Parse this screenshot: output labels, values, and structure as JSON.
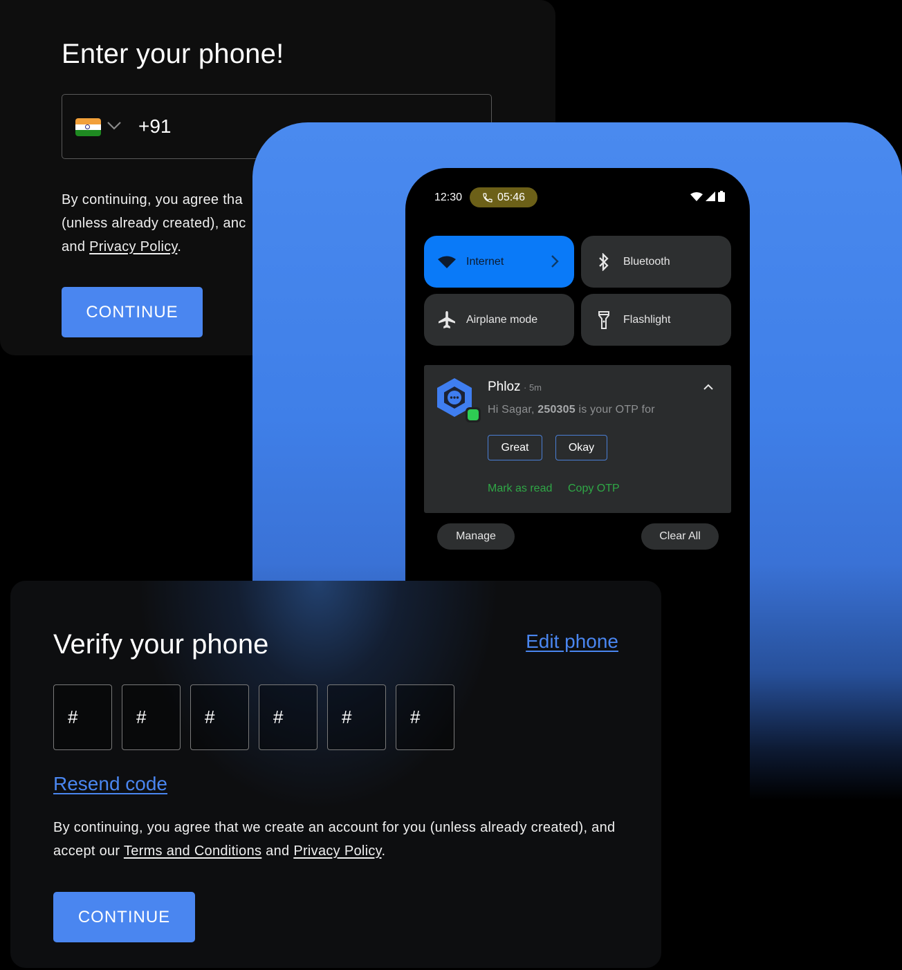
{
  "enter_phone_card": {
    "title": "Enter your phone!",
    "country_flag": "india-flag",
    "dial_code": "+91",
    "consent_lines": [
      "By continuing, you agree tha",
      "(unless already created), anc"
    ],
    "consent_line3_prefix": "and ",
    "privacy_link": "Privacy Policy",
    "consent_line3_suffix": ".",
    "continue_label": "CONTINUE"
  },
  "phone": {
    "status_bar": {
      "time": "12:30",
      "call_timer": "05:46"
    },
    "quick_tiles": [
      {
        "label": "Internet",
        "icon": "wifi-icon",
        "active": true
      },
      {
        "label": "Bluetooth",
        "icon": "bluetooth-icon",
        "active": false
      },
      {
        "label": "Airplane mode",
        "icon": "airplane-icon",
        "active": false
      },
      {
        "label": "Flashlight",
        "icon": "flashlight-icon",
        "active": false
      }
    ],
    "notification": {
      "app_name": "Phloz",
      "time_ago": "· 5m",
      "message_prefix": "Hi Sagar, ",
      "otp": "250305",
      "message_suffix": " is your OTP for",
      "replies": [
        "Great",
        "Okay"
      ],
      "actions": [
        "Mark as read",
        "Copy OTP"
      ]
    },
    "manage_label": "Manage",
    "clear_all_label": "Clear All"
  },
  "verify_card": {
    "title": "Verify your phone",
    "edit_phone_label": "Edit phone",
    "otp_placeholders": [
      "#",
      "#",
      "#",
      "#",
      "#",
      "#"
    ],
    "resend_label": "Resend code",
    "consent_prefix": "By continuing, you agree that we create an account for you (unless already created), and accept our ",
    "terms_link": "Terms and Conditions",
    "consent_and": " and ",
    "privacy_link": "Privacy Policy",
    "consent_suffix": ".",
    "continue_label": "CONTINUE"
  },
  "colors": {
    "accent_blue": "#4a86f0",
    "active_tile": "#0a7af8",
    "action_green": "#2fa846",
    "call_pill": "#6c6018"
  }
}
